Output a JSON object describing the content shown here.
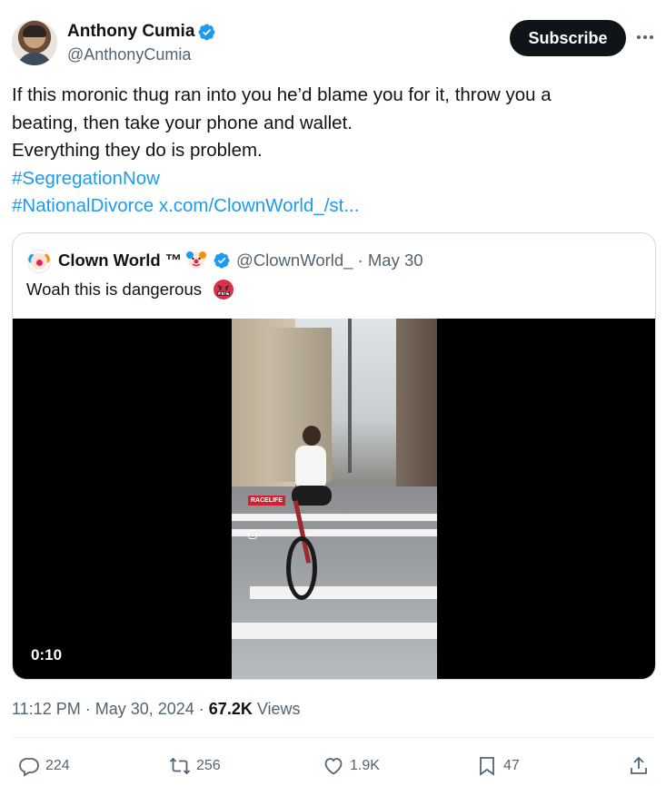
{
  "author": {
    "name": "Anthony Cumia",
    "handle": "@AnthonyCumia",
    "avatar_icon": "profile-photo"
  },
  "subscribe_label": "Subscribe",
  "more_icon": "more-horizontal-icon",
  "tweet": {
    "lines": [
      "If this moronic thug ran into you he’d blame you for it, throw you a",
      "beating, then take your phone and wallet.",
      "Everything they do is problem."
    ],
    "hashtag1": "#SegregationNow",
    "hashtag2": "#NationalDivorce",
    "link": "x.com/ClownWorld_/st..."
  },
  "quote": {
    "name": "Clown World ™",
    "handle_date": "@ClownWorld_ · May 30",
    "text": "Woah this is dangerous",
    "video_duration": "0:10",
    "watermark": "RACELIFE"
  },
  "meta": {
    "time_date": "11:12 PM · May 30, 2024 ·",
    "views_count": "67.2K",
    "views_label": "Views"
  },
  "actions": {
    "replies": "224",
    "reposts": "256",
    "likes": "1.9K",
    "bookmarks": "47"
  },
  "colors": {
    "accent": "#1d9bf0",
    "text": "#0f1419",
    "secondary": "#536471",
    "border": "#cfd9de"
  }
}
